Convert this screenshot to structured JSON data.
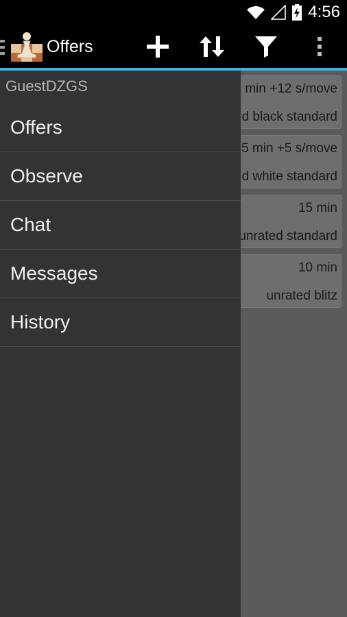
{
  "status_bar": {
    "time": "4:56"
  },
  "action_bar": {
    "title": "Offers",
    "icons": {
      "drawer": "drawer-indicator-icon",
      "app": "chess-pawn-icon",
      "add": "plus-icon",
      "sort": "sort-icon",
      "filter": "filter-icon",
      "overflow": "overflow-menu-icon"
    }
  },
  "colors": {
    "accent": "#33b5e5",
    "drawer_bg": "#333333",
    "content_bg": "#5b5b5b"
  },
  "offers": [
    {
      "time": "min +12 s/move",
      "type": "d black standard"
    },
    {
      "time": "5 min +5 s/move",
      "type": "d white standard"
    },
    {
      "time": "15 min",
      "type": "unrated standard"
    },
    {
      "time": "10 min",
      "type": "unrated blitz"
    }
  ],
  "drawer": {
    "username": "GuestDZGS",
    "items": [
      {
        "label": "Offers"
      },
      {
        "label": "Observe"
      },
      {
        "label": "Chat"
      },
      {
        "label": "Messages"
      },
      {
        "label": "History"
      }
    ]
  }
}
